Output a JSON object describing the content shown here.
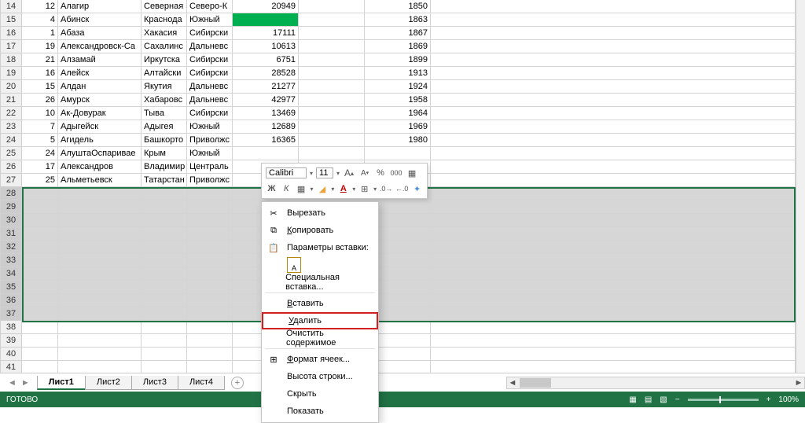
{
  "rows": [
    {
      "n": 14,
      "a": 12,
      "b": "Алагир",
      "c": "Северная",
      "d": "Северо-К",
      "e": 20949,
      "g": 1850
    },
    {
      "n": 15,
      "a": 4,
      "b": "Абинск",
      "c": "Краснода",
      "d": "Южный",
      "e": "",
      "g": 1863,
      "hl": true
    },
    {
      "n": 16,
      "a": 1,
      "b": "Абаза",
      "c": "Хакасия",
      "d": "Сибирски",
      "e": 17111,
      "g": 1867
    },
    {
      "n": 17,
      "a": 19,
      "b": "Александровск-Са",
      "c": "Сахалинс",
      "d": "Дальневс",
      "e": 10613,
      "g": 1869
    },
    {
      "n": 18,
      "a": 21,
      "b": "Алзамай",
      "c": "Иркутска",
      "d": "Сибирски",
      "e": 6751,
      "g": 1899
    },
    {
      "n": 19,
      "a": 16,
      "b": "Алейск",
      "c": "Алтайски",
      "d": "Сибирски",
      "e": 28528,
      "g": 1913
    },
    {
      "n": 20,
      "a": 15,
      "b": "Алдан",
      "c": "Якутия",
      "d": "Дальневс",
      "e": 21277,
      "g": 1924
    },
    {
      "n": 21,
      "a": 26,
      "b": "Амурск",
      "c": "Хабаровс",
      "d": "Дальневс",
      "e": 42977,
      "g": 1958
    },
    {
      "n": 22,
      "a": 10,
      "b": "Ак-Довурак",
      "c": "Тыва",
      "d": "Сибирски",
      "e": 13469,
      "g": 1964
    },
    {
      "n": 23,
      "a": 7,
      "b": "Адыгейск",
      "c": "Адыгея",
      "d": "Южный",
      "e": 12689,
      "g": 1969
    },
    {
      "n": 24,
      "a": 5,
      "b": "Агидель",
      "c": "Башкорто",
      "d": "Приволжс",
      "e": 16365,
      "g": 1980
    },
    {
      "n": 25,
      "a": 24,
      "b": "АлуштаОспаривае",
      "c": "Крым",
      "d": "Южный",
      "e": "",
      "g": ""
    },
    {
      "n": 26,
      "a": 17,
      "b": "Александров",
      "c": "Владимир",
      "d": "Централь",
      "e": "",
      "g": ""
    },
    {
      "n": 27,
      "a": 25,
      "b": "Альметьевск",
      "c": "Татарстан",
      "d": "Приволжс",
      "e": "",
      "g": ""
    }
  ],
  "empty_rows": [
    28,
    29,
    30,
    31,
    32,
    33,
    34,
    35,
    36,
    37
  ],
  "tail_rows": [
    38,
    39,
    40,
    41
  ],
  "sheets": [
    "Лист1",
    "Лист2",
    "Лист3",
    "Лист4"
  ],
  "active_sheet": 0,
  "status": {
    "ready": "ГОТОВО",
    "zoom": "100%"
  },
  "mini_toolbar": {
    "font": "Calibri",
    "size": "11",
    "acts": [
      "Ж",
      "К"
    ]
  },
  "context_menu": {
    "cut": "Вырезать",
    "copy": "Копировать",
    "paste_header": "Параметры вставки:",
    "paste_special": "Специальная вставка...",
    "insert": "Вставить",
    "delete": "Удалить",
    "clear": "Очистить содержимое",
    "format": "Формат ячеек...",
    "row_height": "Высота строки...",
    "hide": "Скрыть",
    "show": "Показать"
  }
}
